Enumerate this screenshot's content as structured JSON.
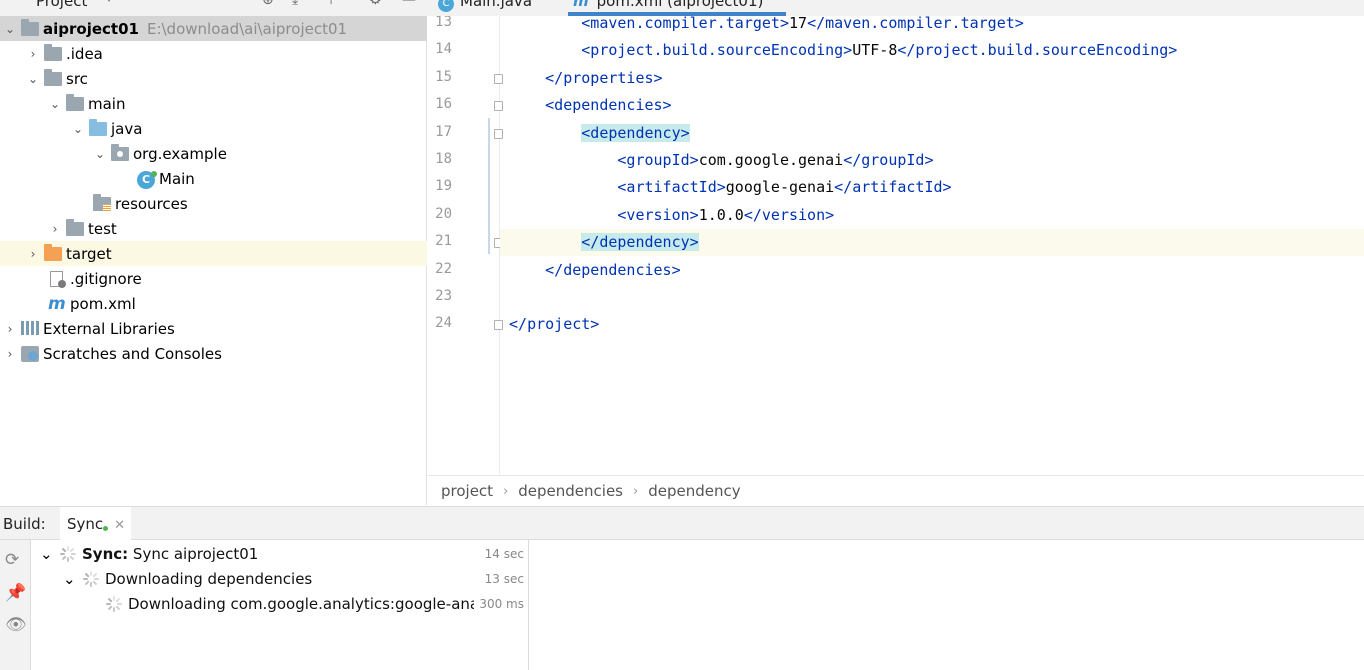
{
  "project_panel": {
    "title": "Project",
    "tree": [
      {
        "label": "aiproject01",
        "path": "E:\\download\\ai\\aiproject01"
      },
      {
        "label": ".idea"
      },
      {
        "label": "src"
      },
      {
        "label": "main"
      },
      {
        "label": "java"
      },
      {
        "label": "org.example"
      },
      {
        "label": "Main"
      },
      {
        "label": "resources"
      },
      {
        "label": "test"
      },
      {
        "label": "target"
      },
      {
        "label": ".gitignore"
      },
      {
        "label": "pom.xml"
      },
      {
        "label": "External Libraries"
      },
      {
        "label": "Scratches and Consoles"
      }
    ]
  },
  "editor_tabs": [
    {
      "label": "Main.java",
      "icon": "class-icon"
    },
    {
      "label": "pom.xml (aiproject01)",
      "icon": "maven-icon",
      "active": true
    }
  ],
  "editor": {
    "lines": [
      {
        "num": "13",
        "open": "<maven.compiler.target>",
        "text": "17",
        "close": "</maven.compiler.target>"
      },
      {
        "num": "14",
        "open": "<project.build.sourceEncoding>",
        "text": "UTF-8",
        "close": "</project.build.sourceEncoding>"
      },
      {
        "num": "15",
        "open": "",
        "text": "",
        "close": "</properties>"
      },
      {
        "num": "16",
        "open": "<dependencies>",
        "text": "",
        "close": ""
      },
      {
        "num": "17",
        "open": "<dependency>",
        "text": "",
        "close": ""
      },
      {
        "num": "18",
        "open": "<groupId>",
        "text": "com.google.genai",
        "close": "</groupId>"
      },
      {
        "num": "19",
        "open": "<artifactId>",
        "text": "google-genai",
        "close": "</artifactId>"
      },
      {
        "num": "20",
        "open": "<version>",
        "text": "1.0.0",
        "close": "</version>"
      },
      {
        "num": "21",
        "open": "",
        "text": "",
        "close": "</dependency>"
      },
      {
        "num": "22",
        "open": "",
        "text": "",
        "close": "</dependencies>"
      },
      {
        "num": "23",
        "open": "",
        "text": "",
        "close": ""
      },
      {
        "num": "24",
        "open": "",
        "text": "",
        "close": "</project>"
      }
    ]
  },
  "breadcrumbs": [
    "project",
    "dependencies",
    "dependency"
  ],
  "build": {
    "label": "Build:",
    "tab_label": "Sync",
    "rows": [
      {
        "bold": "Sync:",
        "text": " Sync aiproject01",
        "time": "14 sec"
      },
      {
        "text": "Downloading dependencies",
        "time": "13 sec"
      },
      {
        "text": "Downloading com.google.analytics:google-ana",
        "time": "300 ms"
      }
    ]
  },
  "colors": {
    "tag": "#0033b3",
    "tag_highlight": "#c7ebeb",
    "selected_row": "#d5d5d5",
    "current_line": "#fcfaed"
  }
}
